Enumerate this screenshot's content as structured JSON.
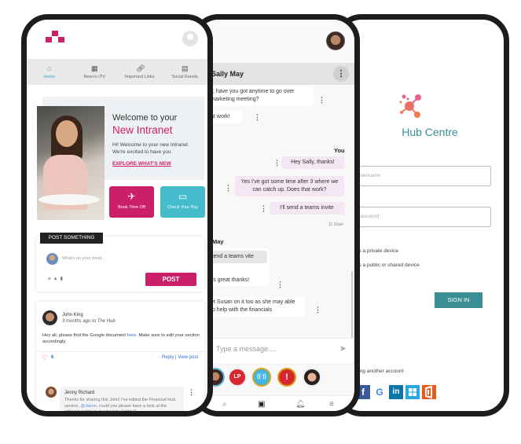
{
  "intranet": {
    "nav": [
      {
        "label": "Home",
        "icon": "home-icon",
        "active": true
      },
      {
        "label": "New to ITV",
        "icon": "calculator-icon",
        "active": false
      },
      {
        "label": "Important Links",
        "icon": "link-icon",
        "active": false
      },
      {
        "label": "Social Events",
        "icon": "calendar-icon",
        "active": false
      }
    ],
    "hero": {
      "title_line1": "Welcome to your",
      "title_line2": "New Intranet",
      "text": "Hi! Welcome to your new Intranet. We're excited to have you.",
      "link": "EXPLORE WHAT'S NEW"
    },
    "tiles": [
      {
        "label": "Book Time Off",
        "icon": "plane-icon",
        "color": "#cc1f6a"
      },
      {
        "label": "Check Your Pay",
        "icon": "card-icon",
        "color": "#44bccb"
      }
    ],
    "post": {
      "tag": "POST SOMETHING",
      "placeholder": "What's on your mind...",
      "button": "POST"
    },
    "feed": {
      "author": "John King",
      "meta": "3 months ago to The Hub",
      "text_before": "Hey all, please find the Google document ",
      "link": "here",
      "text_after": ". Make sure to edit your section accordingly.",
      "likes": "6",
      "reply": "Reply",
      "view": "View post",
      "comment": {
        "author": "Jenny Richard",
        "text_before": "Thanks for sharing this John! I've edited the Financial Hub section, ",
        "mention": "@Jason",
        "text_after": ", could you please have a look at the editorial numbers involved by Friday?"
      }
    }
  },
  "chat": {
    "contact": "Sally May",
    "messages_top": [
      {
        "text": "y, have you got anytime to go over marketing meeting?"
      },
      {
        "text": "at work!"
      }
    ],
    "you_label": "You",
    "messages_out": [
      {
        "text": "Hey Sally, thanks!"
      },
      {
        "text": "Yes I've got some time after 3 where we can catch up. Does that work?"
      },
      {
        "text": "I'll send a teams invite"
      }
    ],
    "out_time": "11:32am",
    "other_label": "May",
    "messages_in": [
      {
        "text": "send a teams vite"
      },
      {
        "text": "t's great thanks!"
      },
      {
        "text": "et Susan on it too as she may able to help with the financials"
      }
    ],
    "input_placeholder": "Type a message....",
    "contacts": [
      {
        "name": "bearded-man"
      },
      {
        "name": "LP",
        "color": "#d8272f"
      },
      {
        "name": "broadcast",
        "color": "#3fb6e4"
      },
      {
        "name": "alert",
        "color": "#d8272f"
      },
      {
        "name": "woman"
      }
    ]
  },
  "login": {
    "title": "Hub Centre",
    "username_placeholder": "Username",
    "password_placeholder": "Password",
    "option_private": "is a private device",
    "option_public": "is a public or shared device",
    "signin": "SIGN IN",
    "other_account": "sing another account",
    "providers": [
      "facebook",
      "google",
      "linkedin",
      "windows",
      "office"
    ]
  }
}
